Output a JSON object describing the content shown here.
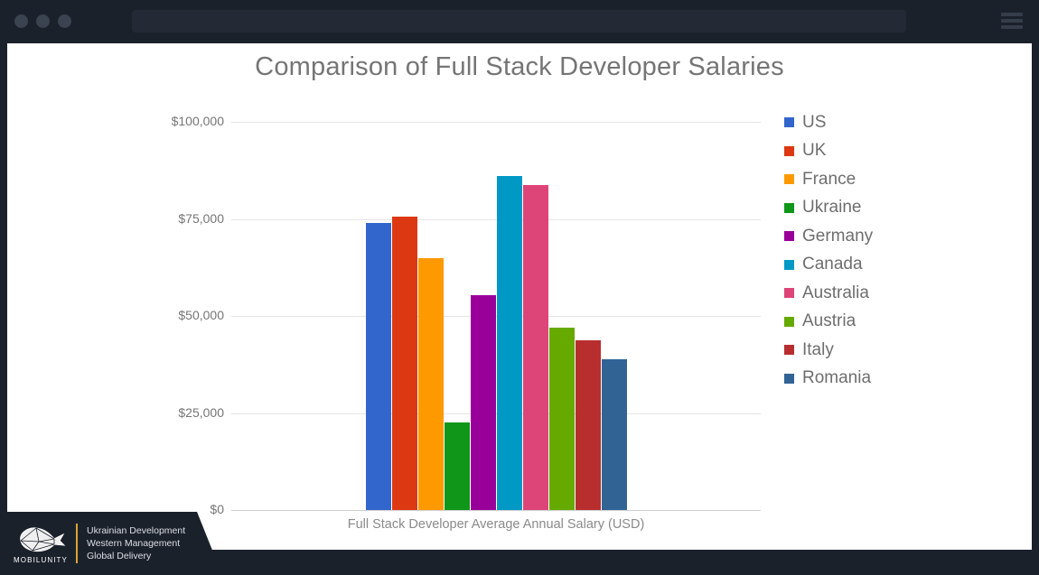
{
  "browser": {
    "traffic_lights": [
      "close",
      "minimize",
      "maximize"
    ],
    "address_value": "",
    "address_placeholder": "",
    "menu_icon": "hamburger-menu-icon"
  },
  "slide": {
    "title": "Comparison of Full Stack Developer Salaries",
    "xlabel": "Full Stack Developer Average Annual Salary (USD)"
  },
  "watermark": {
    "logo_icon": "mobilunity-whale-logo",
    "brand": "MOBILUNITY",
    "tagline_line1": "Ukrainian Development",
    "tagline_line2": "Western Management",
    "tagline_line3": "Global Delivery",
    "divider_color": "#d8a537"
  },
  "chart_data": {
    "type": "bar",
    "title": "Comparison of Full Stack Developer Salaries",
    "xlabel": "Full Stack Developer Average Annual Salary (USD)",
    "ylabel": "",
    "categories": [
      "US",
      "UK",
      "France",
      "Ukraine",
      "Germany",
      "Canada",
      "Australia",
      "Austria",
      "Italy",
      "Romania"
    ],
    "values": [
      74000,
      75500,
      65000,
      22500,
      55300,
      86000,
      83700,
      47000,
      43700,
      38800
    ],
    "colors": [
      "#3366cc",
      "#dc3912",
      "#ff9900",
      "#109618",
      "#990099",
      "#0099c6",
      "#dd4477",
      "#66aa00",
      "#b82e2e",
      "#316395"
    ],
    "ylim": [
      0,
      100000
    ],
    "yticks": [
      0,
      25000,
      50000,
      75000,
      100000
    ],
    "ytick_labels": [
      "$0",
      "$25,000",
      "$50,000",
      "$75,000",
      "$100,000"
    ],
    "grid": true,
    "legend_position": "right",
    "legend": [
      {
        "label": "US",
        "color": "#3366cc"
      },
      {
        "label": "UK",
        "color": "#dc3912"
      },
      {
        "label": "France",
        "color": "#ff9900"
      },
      {
        "label": "Ukraine",
        "color": "#109618"
      },
      {
        "label": "Germany",
        "color": "#990099"
      },
      {
        "label": "Canada",
        "color": "#0099c6"
      },
      {
        "label": "Australia",
        "color": "#dd4477"
      },
      {
        "label": "Austria",
        "color": "#66aa00"
      },
      {
        "label": "Italy",
        "color": "#b82e2e"
      },
      {
        "label": "Romania",
        "color": "#316395"
      }
    ]
  }
}
